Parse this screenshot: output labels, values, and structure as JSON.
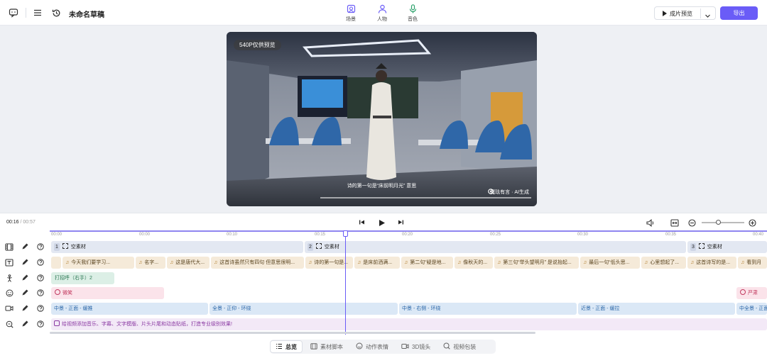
{
  "app": {
    "doc_title": "未命名草稿",
    "top_tabs": [
      {
        "label": "场景",
        "icon": "scene-icon"
      },
      {
        "label": "人物",
        "icon": "person-icon"
      },
      {
        "label": "音色",
        "icon": "microphone-icon"
      }
    ],
    "preview_label": "成片预览",
    "export_label": "导出",
    "accent": "#6a5cf7"
  },
  "video": {
    "resolution_badge": "540P仅供预览",
    "subtitle": "诗的第一句是“床前明月光” 意思",
    "watermark": "魔珐有言 · AI生成"
  },
  "timeline": {
    "current_time": "00:16",
    "separator": " / ",
    "total_time": "00:57",
    "ruler_ticks": [
      "00:00",
      "00:00",
      "00:10",
      "00:15",
      "00:20",
      "00:25",
      "00:30",
      "00:35",
      "00:40"
    ],
    "scene_clips": [
      {
        "num": "1",
        "label": "空素材"
      },
      {
        "num": "2",
        "label": "空素材"
      },
      {
        "num": "3",
        "label": "空素材"
      }
    ],
    "tts_clips": [
      "今天我们要学习...",
      "名字...",
      "这是唐代大...",
      "这首诗虽然只有四句 但意思很明...",
      "诗的第一句是...",
      "是床前洒满...",
      "第二句“疑是地...",
      "像秋天的...",
      "第三句“举头望明月” 是说抬起...",
      "最后一句“低头思...",
      "心里想起了...",
      "这首诗写的是...",
      "看到月"
    ],
    "gesture_clips": [
      "打招呼（右手）2"
    ],
    "expression_clips": [
      "微笑",
      "严肃"
    ],
    "camera_clips": [
      "中景 - 正面 - 缓推",
      "全景 - 正仰 - 环绕",
      "中景 - 右侧 - 环绕",
      "近景 - 正面 - 缓拉",
      "中全景 - 正面"
    ],
    "pack_tip": "给视频添加音乐、字幕、文字模版、片头片尾和动态贴纸，打造专业级别效果!"
  },
  "bottom_tabs": [
    {
      "label": "总览",
      "active": true
    },
    {
      "label": "素材脚本",
      "active": false
    },
    {
      "label": "动作表情",
      "active": false
    },
    {
      "label": "3D镜头",
      "active": false
    },
    {
      "label": "视频包装",
      "active": false
    }
  ]
}
